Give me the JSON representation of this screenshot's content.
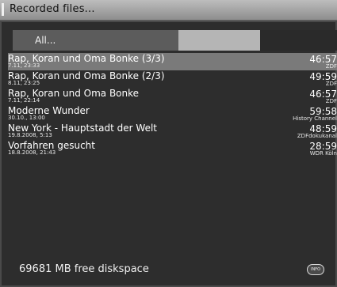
{
  "window": {
    "title": "Recorded files..."
  },
  "filter": {
    "all_label": "All..."
  },
  "recordings": [
    {
      "title": "Rap, Koran und Oma Bonke (3/3)",
      "date": "7.11, 23:33",
      "duration": "46:57",
      "channel": "ZDF",
      "selected": true
    },
    {
      "title": "Rap, Koran und Oma Bonke (2/3)",
      "date": "8.11, 23:25",
      "duration": "49:59",
      "channel": "ZDF",
      "selected": false
    },
    {
      "title": "Rap, Koran und Oma Bonke",
      "date": "7.11, 22:14",
      "duration": "46:57",
      "channel": "ZDF",
      "selected": false
    },
    {
      "title": "Moderne Wunder",
      "date": "30.10., 13:00",
      "duration": "59:58",
      "channel": "History Channel",
      "selected": false
    },
    {
      "title": "New York - Hauptstadt der Welt",
      "date": "19.8.2008, 5:13",
      "duration": "48:59",
      "channel": "ZDFdokukanal",
      "selected": false
    },
    {
      "title": "Vorfahren gesucht",
      "date": "18.8.2008, 21:43",
      "duration": "28:59",
      "channel": "WDR Köln",
      "selected": false
    }
  ],
  "footer": {
    "diskspace": "69681 MB free diskspace",
    "button_label": "INFO"
  }
}
